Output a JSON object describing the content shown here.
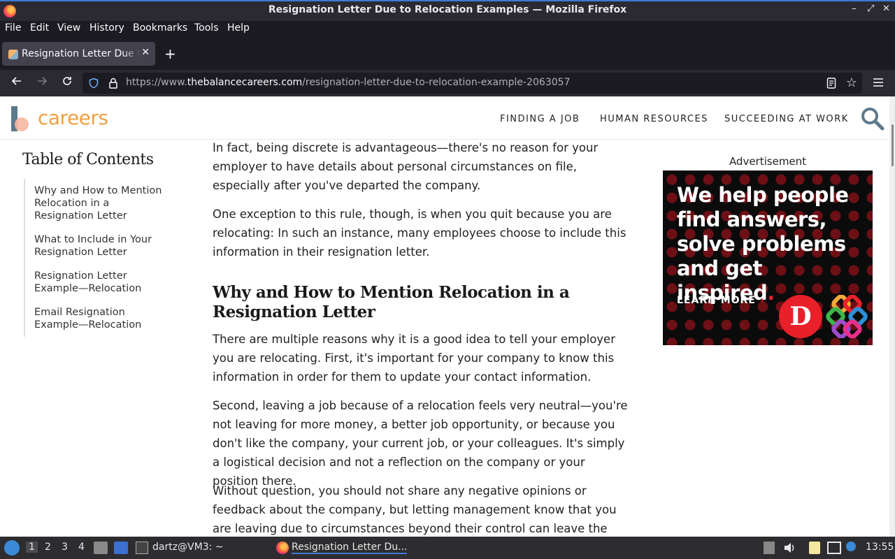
{
  "window": {
    "title": "Resignation Letter Due to Relocation Examples — Mozilla Firefox",
    "controls": [
      "–",
      "⤢",
      "✕"
    ]
  },
  "menubar": {
    "items": [
      "File",
      "Edit",
      "View",
      "History",
      "Bookmarks",
      "Tools",
      "Help"
    ]
  },
  "tabs": [
    {
      "label": "Resignation Letter Due to Relocation Examples",
      "close": "✕"
    }
  ],
  "newtab_label": "+",
  "nav": {
    "url_prefix": "https://www.",
    "url_domain": "thebalancecareers.com",
    "url_path": "/resignation-letter-due-to-relocation-example-2063057"
  },
  "site": {
    "logo_text": "careers",
    "nav_links": [
      "FINDING A JOB",
      "HUMAN RESOURCES",
      "SUCCEEDING AT WORK"
    ]
  },
  "toc": {
    "title": "Table of Contents",
    "items": [
      "Why and How to Mention Relocation in a Resignation Letter",
      "What to Include in Your Resignation Letter",
      "Resignation Letter Example—Relocation",
      "Email Resignation Example—Relocation"
    ]
  },
  "article": {
    "paragraphs_top": [
      "In fact, being discrete is advantageous—there's no reason for your employer to have details about personal circumstances on file, especially after you've departed the company.",
      "One exception to this rule, though, is when you quit because you are relocating: In such an instance, many employees choose to include this information in their resignation letter."
    ],
    "heading": "Why and How to Mention Relocation in a Resignation Letter",
    "paragraphs_bottom": [
      "There are multiple reasons why it is a good idea to tell your employer you are relocating. First, it's important for your company to know this information in order for them to update your contact information.",
      "Second, leaving a job because of a relocation feels very neutral—you're not leaving for more money, a better job opportunity, or because you don't like the company, your current job, or your colleagues. It's simply a logistical decision and not a reflection on the company or your position there.",
      "Without question, you should not share any negative opinions or feedback about the company, but letting management know that you are leaving due to circumstances beyond their control can leave the door open for the"
    ]
  },
  "ad": {
    "label": "Advertisement",
    "headline_lines": [
      "We help people",
      "find answers,",
      "solve problems",
      "and get inspired"
    ],
    "headline_dot": ".",
    "cta": "LEARN MORE",
    "cta_arrow": "›",
    "logo_letter": "D"
  },
  "taskbar": {
    "workspaces": [
      "1",
      "2",
      "3",
      "4"
    ],
    "tasks": [
      "dartz@VM3: ~",
      "Resignation Letter Du..."
    ],
    "clock": "13:55"
  }
}
